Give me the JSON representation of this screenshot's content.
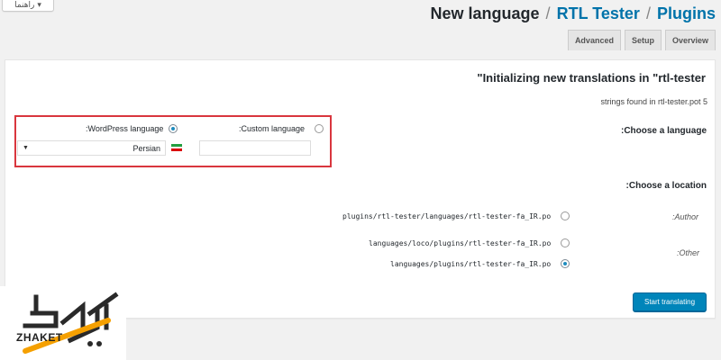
{
  "help_tab": {
    "label": "راهنما",
    "arrow": "▾"
  },
  "heading": {
    "title": "New language",
    "separator": "/",
    "plugin_link": "RTL Tester",
    "section_link": "Plugins"
  },
  "tabs": [
    {
      "label": "Advanced"
    },
    {
      "label": "Setup"
    },
    {
      "label": "Overview"
    }
  ],
  "panel": {
    "title": "\"Initializing new translations in \"rtl-tester",
    "strings_found": "strings found in rtl-tester.pot 5",
    "choose_language": ":Choose a language",
    "wordpress_language_label": ":WordPress language",
    "custom_language_label": ":Custom language",
    "selected_language": "Persian",
    "custom_language_value": "",
    "choose_location": ":Choose a location",
    "author_label": ":Author",
    "other_label": ":Other",
    "locations": [
      {
        "path": "plugins/rtl-tester/languages/rtl-tester-fa_IR.po",
        "checked": false
      },
      {
        "path": "languages/loco/plugins/rtl-tester-fa_IR.po",
        "checked": false
      },
      {
        "path": "languages/plugins/rtl-tester-fa_IR.po",
        "checked": true
      }
    ],
    "start_button": "Start translating"
  },
  "watermark": {
    "brand": "ZHAKET"
  },
  "colors": {
    "link": "#0073aa",
    "highlight_border": "#d9363e",
    "primary_button": "#0085ba",
    "radio_checked": "#1e8cbe"
  }
}
